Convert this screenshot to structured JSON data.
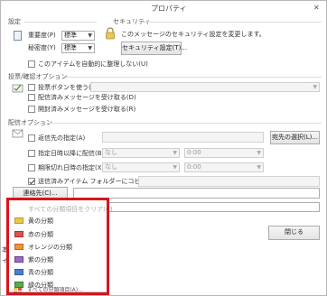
{
  "window": {
    "title": "プロパティ",
    "close_glyph": "✕"
  },
  "settings": {
    "section": "設定",
    "importance_label": "重要度(P)",
    "importance_value": "標準",
    "sensitivity_label": "秘密度(Y)",
    "sensitivity_value": "標準",
    "autoarchive_label": "このアイテムを自動的に整理しない(U)"
  },
  "security": {
    "section": "セキュリティ",
    "text": "このメッセージのセキュリティ設定を変更します。",
    "button": "セキュリティ設定(T)..."
  },
  "voting": {
    "section": "投票/確認オプション",
    "voting_label": "投票ボタンを使う(U)",
    "delivery_label": "配信済みメッセージを受け取る(D)",
    "read_label": "開封済みメッセージを受け取る(R)"
  },
  "delivery": {
    "section": "配信オプション",
    "reply_label": "返信先の指定(A)",
    "select_names_button": "宛先の選択(L)...",
    "delay_label": "指定日時以降に配信(B)",
    "delay_date": "なし",
    "delay_time": "0:00",
    "expire_label": "期限切れ日時の指定(X)",
    "expire_date": "なし",
    "expire_time": "0:00",
    "save_sent_label": "送信済みアイテム フォルダーにコピーを保存する(S)",
    "contacts_button": "連絡先(C)..."
  },
  "dropdown": {
    "items": [
      "すべての分類項目をクリア(C)",
      "黄の分類",
      "赤の分類",
      "オレンジの分類",
      "紫の分類",
      "青の分類",
      "緑の分類",
      "すべての分類項目(A)..."
    ],
    "colors": [
      "#e9c84a",
      "#d9534f",
      "#f0933c",
      "#9b6bbf",
      "#4a7fd0",
      "#5cab4c"
    ],
    "highlight_color": "#d9141e"
  },
  "footer": {
    "close_button": "閉じる",
    "side_text_1": "本",
    "side_text_2": "イ"
  }
}
